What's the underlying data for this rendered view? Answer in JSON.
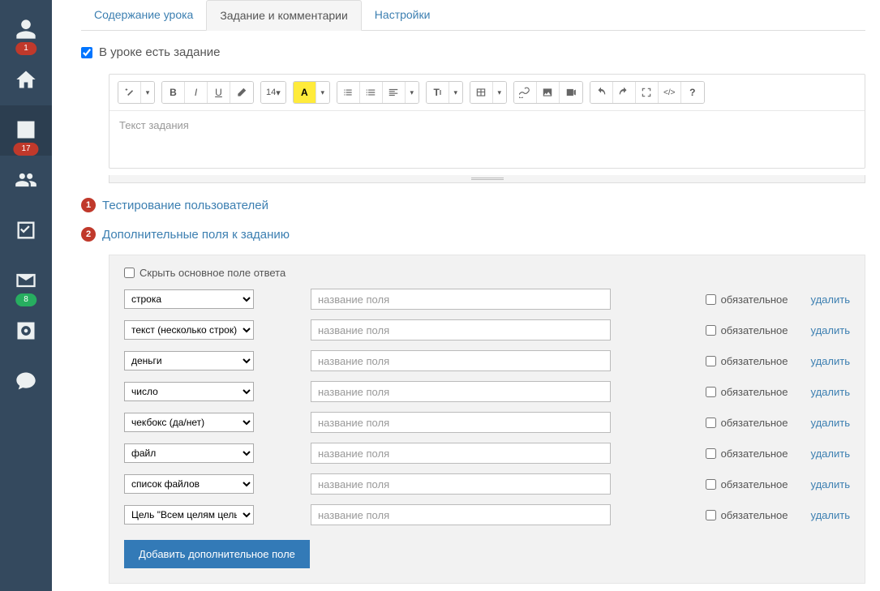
{
  "sidebar": {
    "items": [
      {
        "name": "profile",
        "badge": "1",
        "badge_color": "red"
      },
      {
        "name": "home"
      },
      {
        "name": "stats",
        "badge": "17",
        "badge_color": "red",
        "active": true
      },
      {
        "name": "users"
      },
      {
        "name": "tasks"
      },
      {
        "name": "mail",
        "badge": "8",
        "badge_color": "green"
      },
      {
        "name": "settings"
      },
      {
        "name": "chat"
      }
    ]
  },
  "tabs": [
    {
      "label": "Содержание урока"
    },
    {
      "label": "Задание и комментарии",
      "active": true
    },
    {
      "label": "Настройки"
    }
  ],
  "has_task_label": "В уроке есть задание",
  "editor_placeholder": "Текст задания",
  "font_size_label": "14",
  "section1_label": "Тестирование пользователей",
  "section2_label": "Дополнительные поля к заданию",
  "hide_main_label": "Скрыть основное поле ответа",
  "name_placeholder": "название поля",
  "required_label": "обязательное",
  "delete_label": "удалить",
  "add_button_label": "Добавить дополнительное поле",
  "field_rows": [
    {
      "type": "строка"
    },
    {
      "type": "текст (несколько строк)"
    },
    {
      "type": "деньги"
    },
    {
      "type": "число"
    },
    {
      "type": "чекбокс (да/нет)"
    },
    {
      "type": "файл"
    },
    {
      "type": "список файлов"
    },
    {
      "type": "Цель \"Всем целям цель\""
    }
  ]
}
